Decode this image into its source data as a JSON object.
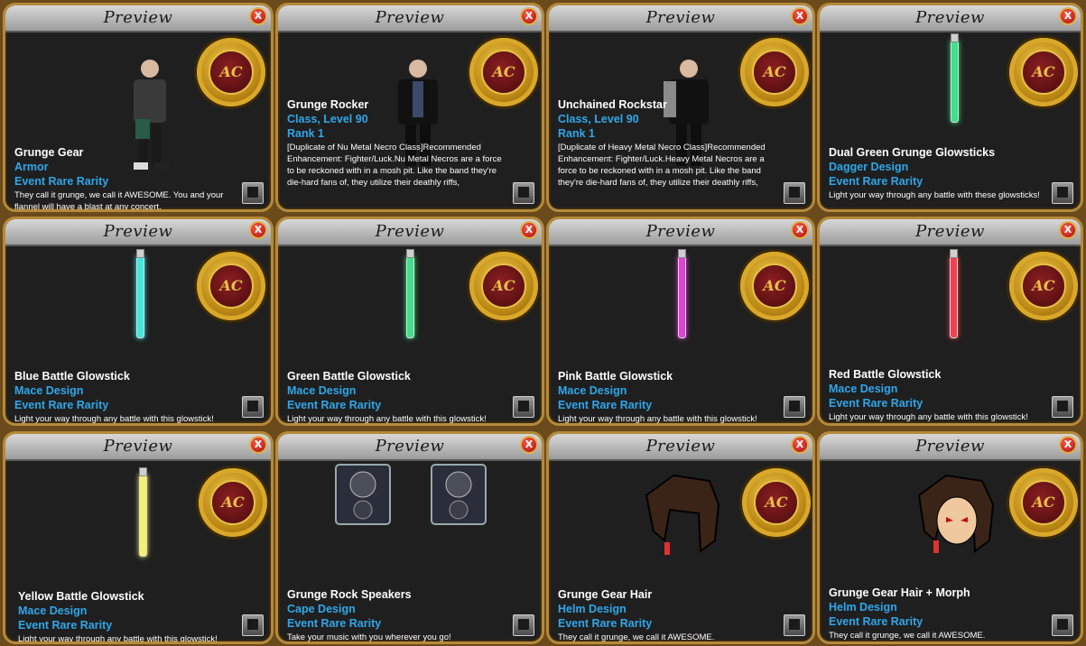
{
  "title": "Preview",
  "close_label": "X",
  "coin_label": "AC",
  "panels": [
    {
      "name": "Grunge Gear",
      "type": "Armor",
      "rank": "",
      "rarity": "Event Rare Rarity",
      "desc": "They call it grunge, we call it AWESOME.  You and your flannel will have a blast at any concert."
    },
    {
      "name": "Grunge Rocker",
      "type": "Class, Level 90",
      "rank": "Rank 1",
      "rarity": "",
      "desc": "[Duplicate of Nu Metal Necro Class]Recommended Enhancement: Fighter/Luck.Nu Metal Necros are a force to be reckoned with in a mosh pit. Like the band they're die-hard fans of, they utilize their deathly riffs,"
    },
    {
      "name": "Unchained Rockstar",
      "type": "Class, Level 90",
      "rank": "Rank 1",
      "rarity": "",
      "desc": "[Duplicate of Heavy Metal Necro Class]Recommended Enhancement: Fighter/Luck.Heavy Metal Necros are a force to be reckoned with in a mosh pit. Like the band they're die-hard fans of, they utilize their deathly riffs,"
    },
    {
      "name": "Dual Green Grunge Glowsticks",
      "type": "Dagger Design",
      "rank": "",
      "rarity": "Event Rare Rarity",
      "desc": "Light your way through any battle with these glowsticks!"
    },
    {
      "name": "Blue Battle Glowstick",
      "type": "Mace Design",
      "rank": "",
      "rarity": "Event Rare Rarity",
      "desc": "Light your way through any battle with this glowstick!"
    },
    {
      "name": "Green Battle Glowstick",
      "type": "Mace Design",
      "rank": "",
      "rarity": "Event Rare Rarity",
      "desc": "Light your way through any battle with this glowstick!"
    },
    {
      "name": "Pink Battle Glowstick",
      "type": "Mace Design",
      "rank": "",
      "rarity": "Event Rare Rarity",
      "desc": "Light your way through any battle with this glowstick!"
    },
    {
      "name": "Red Battle Glowstick",
      "type": "Mace Design",
      "rank": "",
      "rarity": "Event Rare Rarity",
      "desc": "Light your way through any battle with this glowstick!"
    },
    {
      "name": "Yellow Battle Glowstick",
      "type": "Mace Design",
      "rank": "",
      "rarity": "Event Rare Rarity",
      "desc": "Light your way through any battle with this glowstick!"
    },
    {
      "name": "Grunge Rock Speakers",
      "type": "Cape Design",
      "rank": "",
      "rarity": "Event Rare Rarity",
      "desc": "Take your music with you wherever you go!"
    },
    {
      "name": "Grunge Gear Hair",
      "type": "Helm Design",
      "rank": "",
      "rarity": "Event Rare Rarity",
      "desc": "They call it grunge, we call it AWESOME."
    },
    {
      "name": "Grunge Gear Hair + Morph",
      "type": "Helm Design",
      "rank": "",
      "rarity": "Event Rare Rarity",
      "desc": "They call it grunge, we call it AWESOME."
    }
  ],
  "colors": {
    "glow_green": "#3fe08a",
    "glow_blue": "#40e8e0",
    "glow_pink": "#e040d8",
    "glow_red": "#f04050",
    "glow_yellow": "#f2f070"
  }
}
